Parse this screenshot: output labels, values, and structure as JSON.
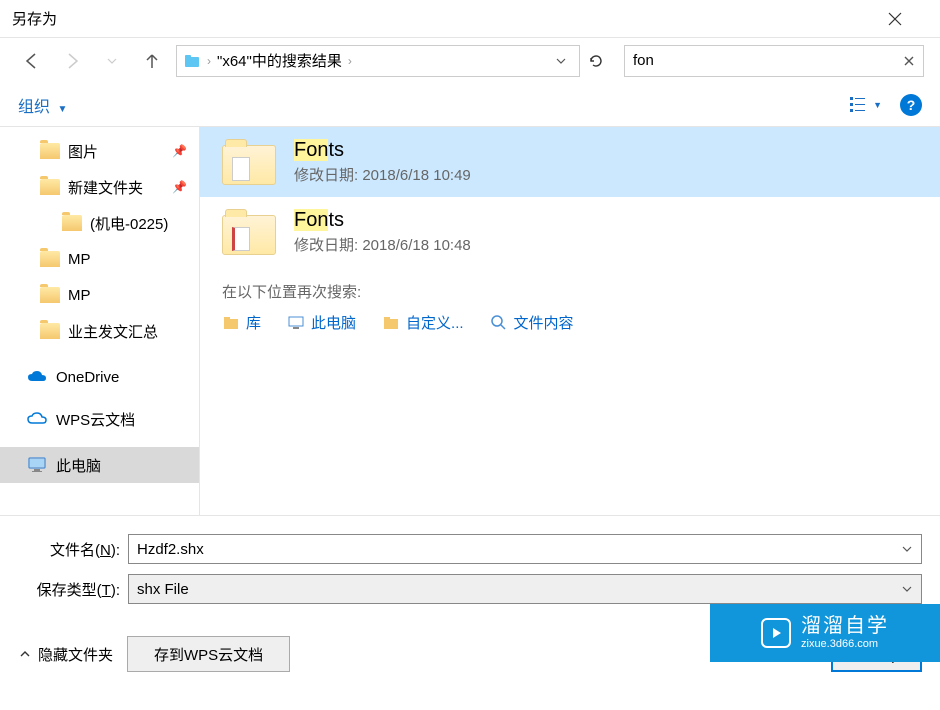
{
  "window": {
    "title": "另存为"
  },
  "nav": {
    "path_label": "\"x64\"中的搜索结果",
    "search_value": "fon"
  },
  "toolbar": {
    "organize": "组织"
  },
  "sidebar": {
    "items": [
      {
        "label": "图片",
        "pinned": true
      },
      {
        "label": "新建文件夹",
        "pinned": true
      },
      {
        "label": "(机电-0225)",
        "indent": true
      },
      {
        "label": "MP"
      },
      {
        "label": "MP"
      },
      {
        "label": "业主发文汇总"
      }
    ],
    "onedrive": "OneDrive",
    "wps": "WPS云文档",
    "pc": "此电脑"
  },
  "results": [
    {
      "name_prefix": "Fon",
      "name_suffix": "ts",
      "meta_label": "修改日期:",
      "meta_value": "2018/6/18 10:49",
      "selected": true
    },
    {
      "name_prefix": "Fon",
      "name_suffix": "ts",
      "meta_label": "修改日期:",
      "meta_value": "2018/6/18 10:48",
      "selected": false,
      "red": true
    }
  ],
  "search_again": {
    "label": "在以下位置再次搜索:",
    "locations": [
      "库",
      "此电脑",
      "自定义...",
      "文件内容"
    ]
  },
  "form": {
    "filename_label_pre": "文件名(",
    "filename_label_key": "N",
    "filename_label_post": "):",
    "filename_value": "Hzdf2.shx",
    "type_label_pre": "保存类型(",
    "type_label_key": "T",
    "type_label_post": "):",
    "type_value": "shx File"
  },
  "footer": {
    "hide_folders": "隐藏文件夹",
    "save_wps": "存到WPS云文档",
    "open": "打开("
  },
  "watermark": {
    "title": "溜溜自学",
    "url": "zixue.3d66.com"
  }
}
